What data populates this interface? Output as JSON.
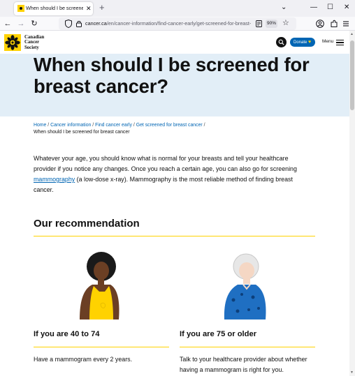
{
  "browser": {
    "tab": {
      "title": "When should I be screened for",
      "close": "✕"
    },
    "new_tab": "+",
    "window_controls": {
      "dropdown": "⌄",
      "minimize": "—",
      "maximize": "☐",
      "close": "✕"
    },
    "nav": {
      "back": "←",
      "forward": "→",
      "reload": "↻"
    },
    "url": {
      "host": "cancer.ca",
      "path": "/en/cancer-information/find-cancer-early/get-screened-for-breast-",
      "zoom": "90%"
    },
    "toolbar_icons": [
      "account-icon",
      "extensions-icon",
      "app-menu-icon"
    ]
  },
  "site": {
    "logo_text": [
      "Canadian",
      "Cancer",
      "Society"
    ],
    "donate_label": "Donate",
    "menu_label": "Menu",
    "colors": {
      "brand_yellow": "#ffd200",
      "brand_blue": "#0065b3",
      "hero_bg": "#e2eef7"
    }
  },
  "hero": {
    "title_line1": "When should I be screened for",
    "title_line2": "breast cancer?"
  },
  "breadcrumb": {
    "items": [
      "Home",
      "Cancer information",
      "Find cancer early",
      "Get screened for breast cancer"
    ],
    "separator": " / ",
    "current": "When should I be screened for breast cancer"
  },
  "intro": {
    "before_link": "Whatever your age, you should know what is normal for your breasts and tell your healthcare provider if you notice any changes. Once you reach a certain age, you can also go for screening",
    "link": "mammography",
    "after_link": " (a low-dose x-ray). Mammography is the most reliable method of finding breast cancer."
  },
  "recommendation": {
    "title": "Our recommendation",
    "cards": [
      {
        "title": "If you are 40 to 74",
        "text": "Have a mammogram every 2 years."
      },
      {
        "title": "If you are 75 or older",
        "text": "Talk to your healthcare provider about whether having a mammogram is right for you."
      }
    ]
  }
}
